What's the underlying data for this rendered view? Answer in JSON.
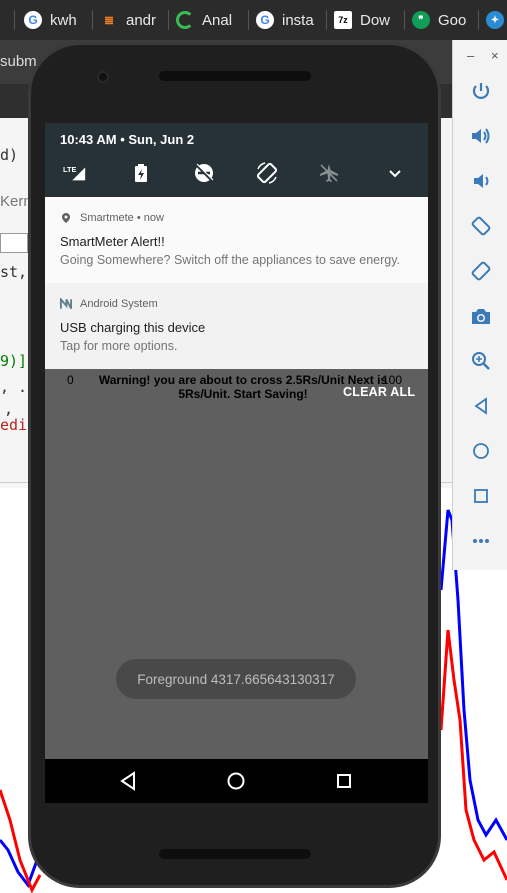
{
  "browser": {
    "tabs": [
      {
        "label": "kwh",
        "icon": "google-icon"
      },
      {
        "label": "andr",
        "icon": "stackoverflow-icon"
      },
      {
        "label": "Anal",
        "icon": "loading-icon"
      },
      {
        "label": "insta",
        "icon": "google-icon"
      },
      {
        "label": "Dow",
        "icon": "7zip-icon"
      },
      {
        "label": "Goo",
        "icon": "hangouts-icon"
      }
    ],
    "address_fragment": "subm",
    "kernel_fragment": "Kern"
  },
  "background_code": {
    "line1": "d)",
    "line2": "st,p",
    "line3": "9)]",
    "line4": ", .",
    "line5": ",",
    "line6": "edic"
  },
  "emulator_panel": {
    "minimize": "–",
    "close": "×",
    "buttons": [
      "power-icon",
      "volume-up-icon",
      "volume-down-icon",
      "rotate-left-icon",
      "rotate-right-icon",
      "camera-icon",
      "zoom-icon",
      "back-icon",
      "home-icon",
      "overview-icon",
      "more-icon"
    ]
  },
  "status": {
    "time_date": "10:43 AM • Sun, Jun 2"
  },
  "quick_settings": {
    "icons": [
      "lte-signal-icon",
      "battery-charging-icon",
      "dnd-off-icon",
      "auto-rotate-icon",
      "airplane-icon",
      "expand-chevron-icon"
    ],
    "lte_label": "LTE"
  },
  "notifications": [
    {
      "app": "Smartmete • now",
      "title": "SmartMeter Alert!!",
      "body": "Going Somewhere? Switch off the appliances to save energy."
    },
    {
      "app": "Android System",
      "title": "USB charging this device",
      "body": "Tap for more options."
    }
  ],
  "warning": {
    "min": "0",
    "max": "100",
    "text": "Warning! you are about to cross 2.5Rs/Unit Next is 5Rs/Unit. Start Saving!"
  },
  "clear_all": "CLEAR ALL",
  "toast": "Foreground 4317.665643130317",
  "colors": {
    "qs_bg": "#263238",
    "scrim": "#5f5f5f",
    "accent": "#3a7ab8"
  }
}
